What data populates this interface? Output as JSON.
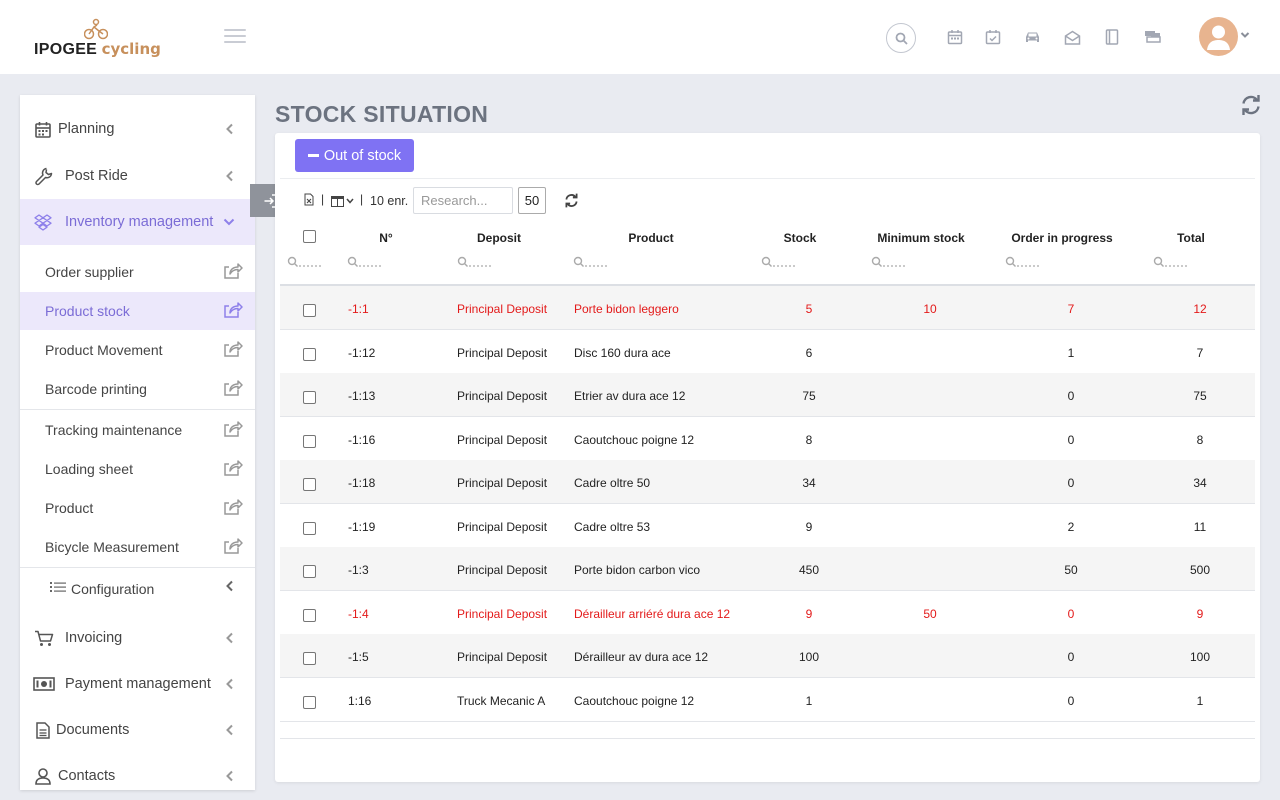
{
  "app": {
    "logo_main": "IPOGEE",
    "logo_sub": "cycling",
    "accent": "#7f72f3",
    "danger": "#e31a1a"
  },
  "topbar": {
    "icons": [
      "search-icon",
      "calendar-icon",
      "calendar-check-icon",
      "car-icon",
      "envelope-open-icon",
      "book-icon",
      "truck-icon"
    ]
  },
  "sidebar": {
    "menu": [
      {
        "label": "Planning",
        "icon": "calendar-icon"
      },
      {
        "label": "Post Ride",
        "icon": "wrench-icon"
      },
      {
        "label": "Inventory management",
        "icon": "dropbox-icon"
      }
    ],
    "submenu": [
      {
        "label": "Order supplier"
      },
      {
        "label": "Product stock"
      },
      {
        "label": "Product Movement"
      },
      {
        "label": "Barcode printing"
      },
      {
        "label": "Tracking maintenance"
      },
      {
        "label": "Loading sheet"
      },
      {
        "label": "Product"
      },
      {
        "label": "Bicycle Measurement"
      }
    ],
    "configuration": "Configuration",
    "menu2": [
      {
        "label": "Invoicing",
        "icon": "cart-icon"
      },
      {
        "label": "Payment management",
        "icon": "money-icon"
      },
      {
        "label": "Documents",
        "icon": "document-icon"
      },
      {
        "label": "Contacts",
        "icon": "user-icon"
      }
    ]
  },
  "main": {
    "title": "STOCK SITUATION",
    "out_of_stock_label": "Out of stock",
    "records_label": "10 enr.",
    "search_placeholder": "Research...",
    "page_size": "50",
    "columns": [
      "N°",
      "Deposit",
      "Product",
      "Stock",
      "Minimum stock",
      "Order in progress",
      "Total"
    ],
    "rows": [
      {
        "n": "-1:1",
        "deposit": "Principal Deposit",
        "product": "Porte bidon leggero",
        "stock": "5",
        "min": "10",
        "order": "7",
        "total": "12",
        "alert": true
      },
      {
        "n": "-1:12",
        "deposit": "Principal Deposit",
        "product": "Disc 160 dura ace",
        "stock": "6",
        "min": "",
        "order": "1",
        "total": "7",
        "alert": false
      },
      {
        "n": "-1:13",
        "deposit": "Principal Deposit",
        "product": "Etrier av dura ace 12",
        "stock": "75",
        "min": "",
        "order": "0",
        "total": "75",
        "alert": false
      },
      {
        "n": "-1:16",
        "deposit": "Principal Deposit",
        "product": "Caoutchouc poigne 12",
        "stock": "8",
        "min": "",
        "order": "0",
        "total": "8",
        "alert": false
      },
      {
        "n": "-1:18",
        "deposit": "Principal Deposit",
        "product": "Cadre oltre 50",
        "stock": "34",
        "min": "",
        "order": "0",
        "total": "34",
        "alert": false
      },
      {
        "n": "-1:19",
        "deposit": "Principal Deposit",
        "product": "Cadre oltre 53",
        "stock": "9",
        "min": "",
        "order": "2",
        "total": "11",
        "alert": false
      },
      {
        "n": "-1:3",
        "deposit": "Principal Deposit",
        "product": "Porte bidon carbon vico",
        "stock": "450",
        "min": "",
        "order": "50",
        "total": "500",
        "alert": false
      },
      {
        "n": "-1:4",
        "deposit": "Principal Deposit",
        "product": "Dérailleur arriéré dura ace 12",
        "stock": "9",
        "min": "50",
        "order": "0",
        "total": "9",
        "alert": true
      },
      {
        "n": "-1:5",
        "deposit": "Principal Deposit",
        "product": "Dérailleur av dura ace 12",
        "stock": "100",
        "min": "",
        "order": "0",
        "total": "100",
        "alert": false
      },
      {
        "n": "1:16",
        "deposit": "Truck Mecanic A",
        "product": "Caoutchouc poigne 12",
        "stock": "1",
        "min": "",
        "order": "0",
        "total": "1",
        "alert": false
      }
    ]
  }
}
